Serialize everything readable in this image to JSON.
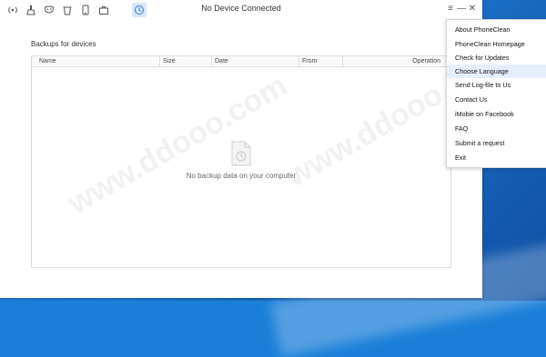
{
  "window": {
    "title": "No Device Connected"
  },
  "toolbar": {
    "icons": [
      "signal-icon",
      "cleaner-brush-icon",
      "mask-icon",
      "trash-icon",
      "phone-icon",
      "briefcase-icon",
      "history-clock-icon"
    ],
    "active_index": 6
  },
  "window_controls": {
    "menu": "≡",
    "minimize": "—",
    "close": "✕"
  },
  "backups": {
    "section_label": "Backups for devices",
    "columns": [
      "Name",
      "Size",
      "Date",
      "From",
      "Operation"
    ],
    "rows": [],
    "empty_message": "No backup data on your computer"
  },
  "menu": {
    "items": [
      "About PhoneClean",
      "PhoneClean Homepage",
      "Check for Updates",
      "Choose Language",
      "Send Log-file to Us",
      "Contact Us",
      "iMobie on Facebook",
      "FAQ",
      "Submit a request",
      "Exit"
    ],
    "highlighted_index": 3
  },
  "colors": {
    "accent": "#d7e6fb",
    "menu_highlight": "#e6eefb",
    "desktop": "#1c6fc7"
  }
}
